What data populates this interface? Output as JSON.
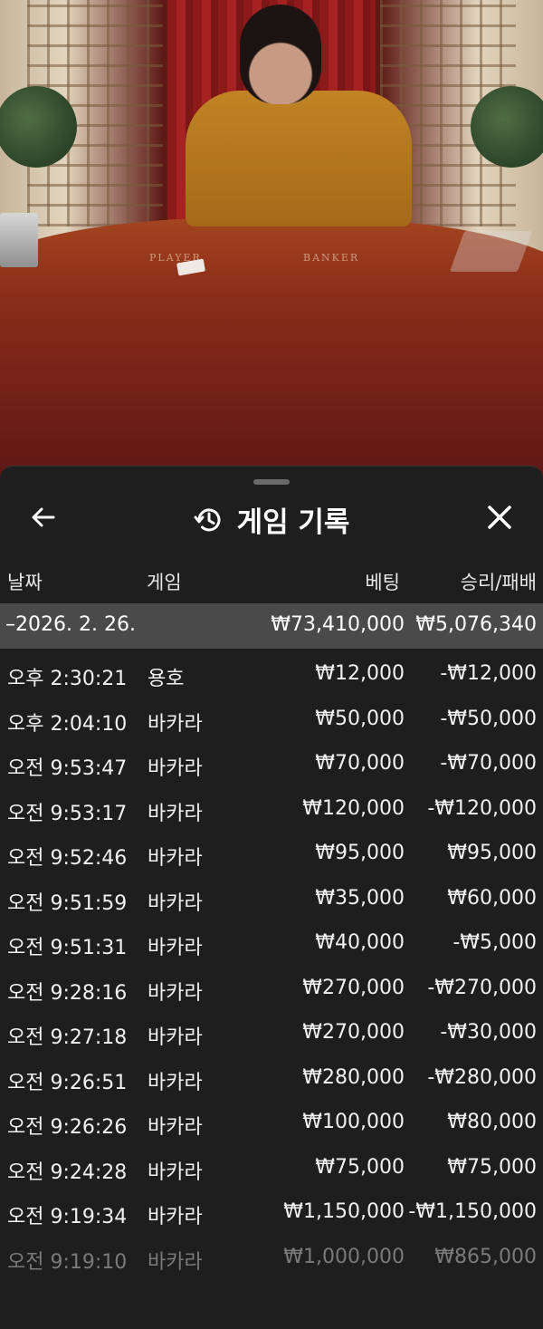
{
  "video": {
    "felt_player_label": "PLAYER",
    "felt_banker_label": "BANKER"
  },
  "sheet": {
    "title": "게임 기록",
    "history_icon": "history-icon",
    "back_icon": "arrow-left-icon",
    "close_icon": "close-icon"
  },
  "columns": {
    "date": "날짜",
    "game": "게임",
    "bet": "베팅",
    "result": "승리/패배"
  },
  "summary": {
    "date": "–2026. 2. 26.",
    "bet_total": "₩73,410,000",
    "result_total": "₩5,076,340"
  },
  "rows": [
    {
      "time": "오후 2:30:21",
      "game": "용호",
      "bet": "₩12,000",
      "result": "-₩12,000"
    },
    {
      "time": "오후 2:04:10",
      "game": "바카라",
      "bet": "₩50,000",
      "result": "-₩50,000"
    },
    {
      "time": "오전 9:53:47",
      "game": "바카라",
      "bet": "₩70,000",
      "result": "-₩70,000"
    },
    {
      "time": "오전 9:53:17",
      "game": "바카라",
      "bet": "₩120,000",
      "result": "-₩120,000"
    },
    {
      "time": "오전 9:52:46",
      "game": "바카라",
      "bet": "₩95,000",
      "result": "₩95,000"
    },
    {
      "time": "오전 9:51:59",
      "game": "바카라",
      "bet": "₩35,000",
      "result": "₩60,000"
    },
    {
      "time": "오전 9:51:31",
      "game": "바카라",
      "bet": "₩40,000",
      "result": "-₩5,000"
    },
    {
      "time": "오전 9:28:16",
      "game": "바카라",
      "bet": "₩270,000",
      "result": "-₩270,000"
    },
    {
      "time": "오전 9:27:18",
      "game": "바카라",
      "bet": "₩270,000",
      "result": "-₩30,000"
    },
    {
      "time": "오전 9:26:51",
      "game": "바카라",
      "bet": "₩280,000",
      "result": "-₩280,000"
    },
    {
      "time": "오전 9:26:26",
      "game": "바카라",
      "bet": "₩100,000",
      "result": "₩80,000"
    },
    {
      "time": "오전 9:24:28",
      "game": "바카라",
      "bet": "₩75,000",
      "result": "₩75,000"
    },
    {
      "time": "오전 9:19:34",
      "game": "바카라",
      "bet": "₩1,150,000",
      "result": "-₩1,150,000"
    },
    {
      "time": "오전 9:19:10",
      "game": "바카라",
      "bet": "₩1,000,000",
      "result": "₩865,000"
    }
  ]
}
